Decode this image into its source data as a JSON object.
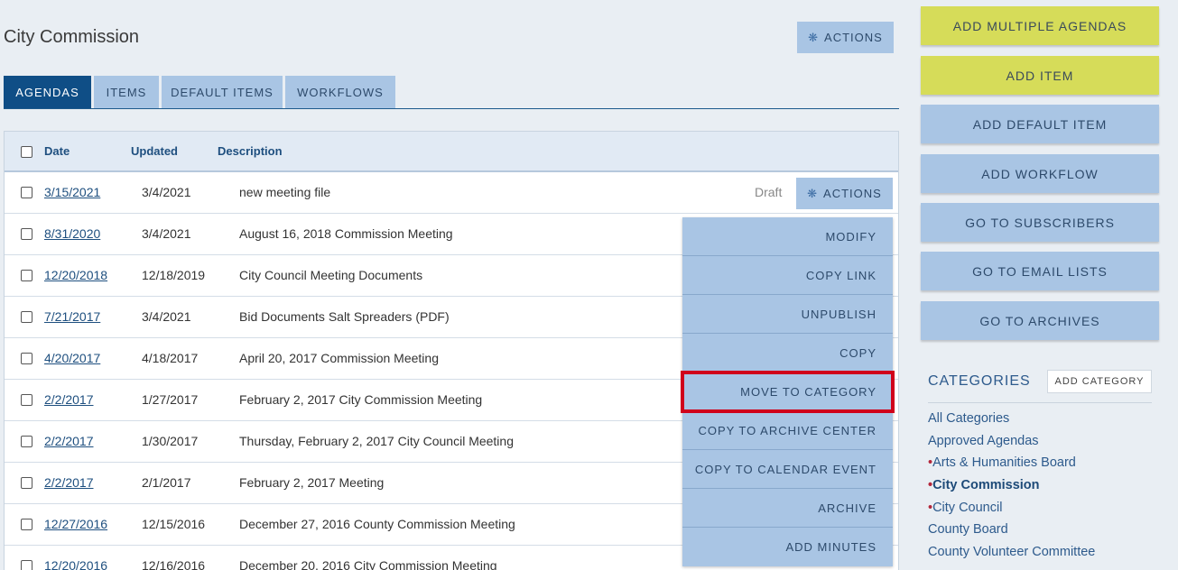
{
  "page_title": "City Commission",
  "top_actions_label": "ACTIONS",
  "tabs": [
    {
      "label": "AGENDAS",
      "active": true
    },
    {
      "label": "ITEMS",
      "active": false
    },
    {
      "label": "DEFAULT ITEMS",
      "active": false
    },
    {
      "label": "WORKFLOWS",
      "active": false
    }
  ],
  "table": {
    "headers": {
      "date": "Date",
      "updated": "Updated",
      "description": "Description"
    },
    "rows": [
      {
        "date": "3/15/2021",
        "updated": "3/4/2021",
        "description": "new meeting file",
        "status": "Draft",
        "actions": "ACTIONS"
      },
      {
        "date": "8/31/2020",
        "updated": "3/4/2021",
        "description": "August 16, 2018 Commission Meeting"
      },
      {
        "date": "12/20/2018",
        "updated": "12/18/2019",
        "description": "City Council Meeting Documents"
      },
      {
        "date": "7/21/2017",
        "updated": "3/4/2021",
        "description": "Bid Documents Salt Spreaders (PDF)"
      },
      {
        "date": "4/20/2017",
        "updated": "4/18/2017",
        "description": "April 20, 2017 Commission Meeting"
      },
      {
        "date": "2/2/2017",
        "updated": "1/27/2017",
        "description": "February 2, 2017 City Commission Meeting"
      },
      {
        "date": "2/2/2017",
        "updated": "1/30/2017",
        "description": "Thursday, February 2, 2017 City Council Meeting"
      },
      {
        "date": "2/2/2017",
        "updated": "2/1/2017",
        "description": "February 2, 2017 Meeting"
      },
      {
        "date": "12/27/2016",
        "updated": "12/15/2016",
        "description": "December 27, 2016 County Commission Meeting"
      },
      {
        "date": "12/20/2016",
        "updated": "12/16/2016",
        "description": "December 20, 2016 City Commission Meeting"
      }
    ]
  },
  "dropdown": {
    "items": [
      "MODIFY",
      "COPY LINK",
      "UNPUBLISH",
      "COPY",
      "MOVE TO CATEGORY",
      "COPY TO ARCHIVE CENTER",
      "COPY TO CALENDAR EVENT",
      "ARCHIVE",
      "ADD MINUTES"
    ],
    "highlighted": "MOVE TO CATEGORY"
  },
  "sidebar": {
    "buttons": [
      {
        "label": "ADD MULTIPLE AGENDAS",
        "color": "#d6dc59"
      },
      {
        "label": "ADD ITEM",
        "color": "#d6dc59"
      },
      {
        "label": "ADD DEFAULT ITEM",
        "color": "#a9c5e4"
      },
      {
        "label": "ADD WORKFLOW",
        "color": "#a9c5e4"
      },
      {
        "label": "GO TO SUBSCRIBERS",
        "color": "#a9c5e4"
      },
      {
        "label": "GO TO EMAIL LISTS",
        "color": "#a9c5e4"
      },
      {
        "label": "GO TO ARCHIVES",
        "color": "#a9c5e4"
      }
    ],
    "categories_heading": "CATEGORIES",
    "add_category_label": "ADD CATEGORY",
    "categories": [
      {
        "label": "All Categories",
        "bullet": false,
        "active": false
      },
      {
        "label": "Approved Agendas",
        "bullet": false,
        "active": false
      },
      {
        "label": "Arts & Humanities Board",
        "bullet": true,
        "active": false
      },
      {
        "label": "City Commission",
        "bullet": true,
        "active": true
      },
      {
        "label": "City Council",
        "bullet": true,
        "active": false
      },
      {
        "label": "County Board",
        "bullet": false,
        "active": false
      },
      {
        "label": "County Volunteer Committee",
        "bullet": false,
        "active": false
      }
    ]
  },
  "colors": {
    "accent": "#0f4e86",
    "button_blue": "#a9c5e4",
    "button_lime": "#d6dc59",
    "highlight": "#d0021b"
  }
}
